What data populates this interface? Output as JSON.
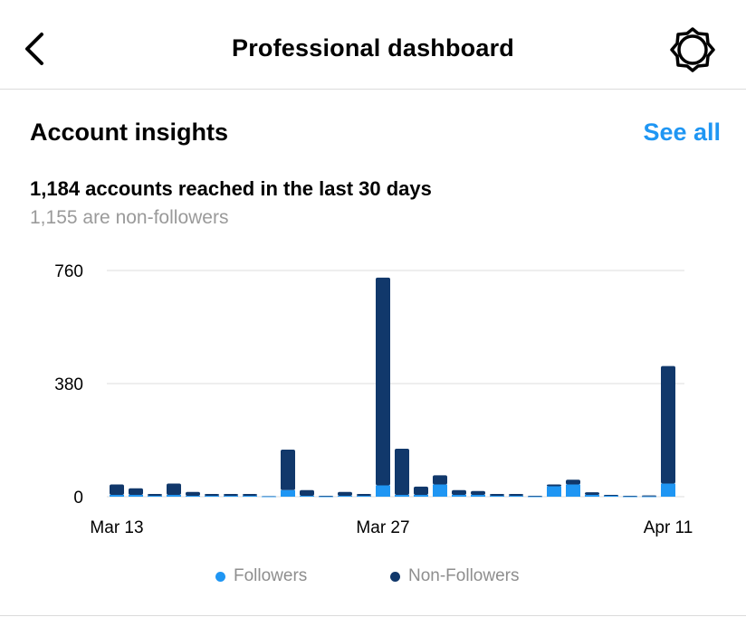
{
  "header": {
    "title": "Professional dashboard",
    "back_icon": "chevron-left-icon",
    "settings_icon": "gear-icon"
  },
  "insights": {
    "section_title": "Account insights",
    "see_all_label": "See all",
    "reach_text": "1,184 accounts reached in the last 30 days",
    "non_followers_text": "1,155 are non-followers"
  },
  "colors": {
    "accent": "#1f96f3",
    "followers": "#1f96f3",
    "non_followers": "#11386b",
    "muted_text": "#9a9a9a",
    "gridline": "#dddddd"
  },
  "legend": {
    "followers_label": "Followers",
    "non_followers_label": "Non-Followers"
  },
  "chart_data": {
    "type": "bar",
    "stacked": true,
    "ylim": [
      0,
      760
    ],
    "y_ticks": [
      "760",
      "380",
      "0"
    ],
    "y_tick_values": [
      760,
      380,
      0
    ],
    "x_tick_labels": [
      "Mar 13",
      "Mar 27",
      "Apr 11"
    ],
    "x_tick_indices": [
      0,
      14,
      29
    ],
    "grid": true,
    "legend_position": "bottom",
    "series": [
      {
        "name": "Followers",
        "values": [
          6,
          6,
          3,
          6,
          3,
          3,
          3,
          3,
          1,
          22,
          3,
          1,
          3,
          3,
          38,
          6,
          6,
          41,
          6,
          6,
          3,
          3,
          1,
          35,
          41,
          6,
          3,
          1,
          1,
          44
        ]
      },
      {
        "name": "Non-Followers",
        "values": [
          35,
          22,
          6,
          38,
          13,
          6,
          6,
          6,
          1,
          136,
          19,
          2,
          13,
          6,
          698,
          155,
          28,
          31,
          16,
          13,
          6,
          6,
          2,
          6,
          16,
          9,
          3,
          2,
          3,
          395
        ]
      }
    ]
  }
}
